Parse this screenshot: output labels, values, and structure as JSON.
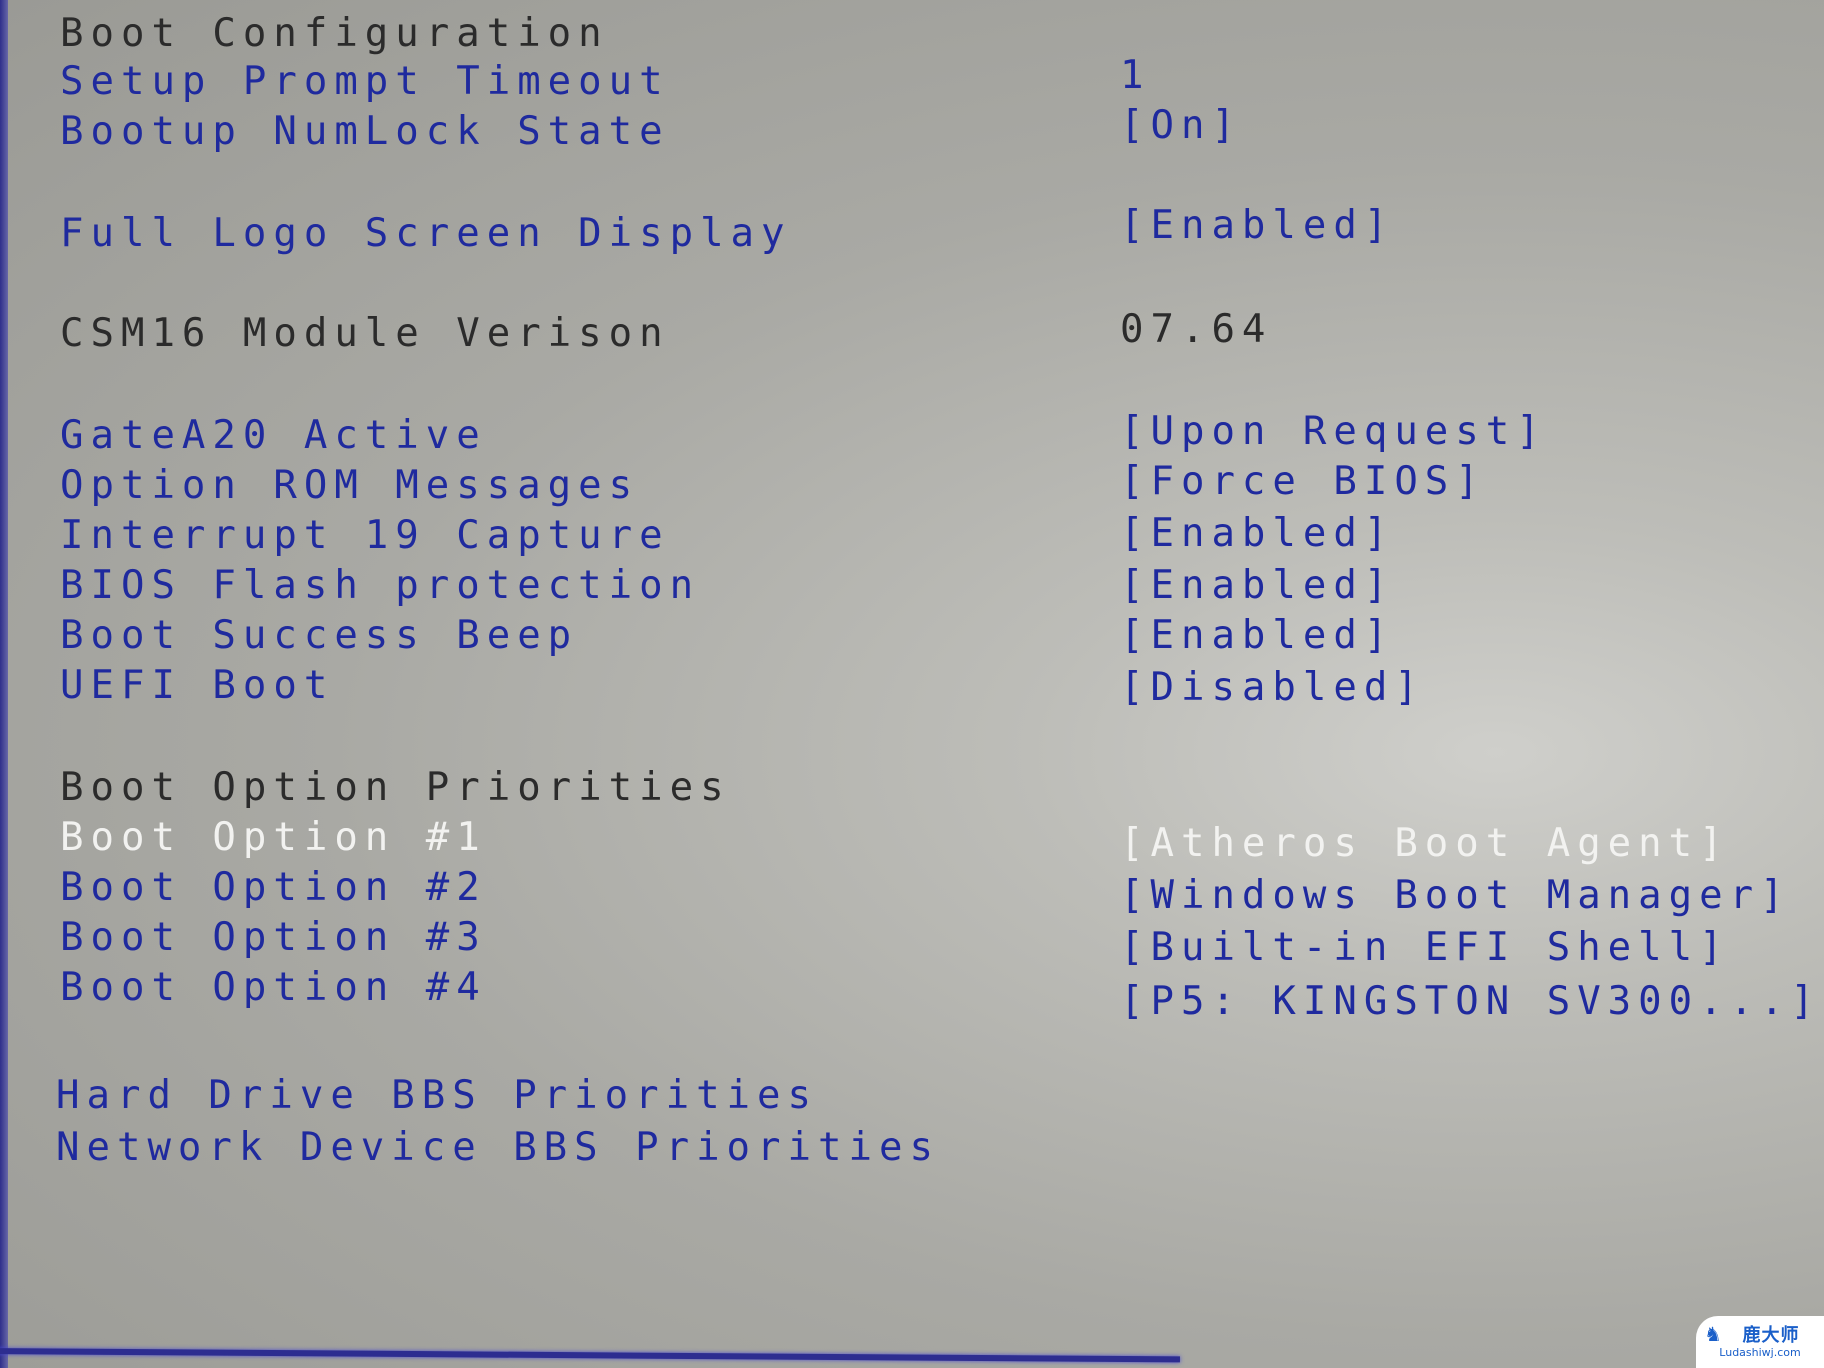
{
  "section_title": "Boot Configuration",
  "settings": [
    {
      "label": "Setup Prompt Timeout",
      "value": "1"
    },
    {
      "label": "Bootup NumLock State",
      "value": "[On]"
    },
    {
      "label": "Full Logo Screen Display",
      "value": "[Enabled]"
    },
    {
      "label": "CSM16 Module Verison",
      "value": "07.64"
    },
    {
      "label": "GateA20 Active",
      "value": "[Upon Request]"
    },
    {
      "label": "Option ROM Messages",
      "value": "[Force BIOS]"
    },
    {
      "label": "Interrupt 19 Capture",
      "value": "[Enabled]"
    },
    {
      "label": "BIOS Flash protection",
      "value": "[Enabled]"
    },
    {
      "label": "Boot Success Beep",
      "value": "[Enabled]"
    },
    {
      "label": "UEFI Boot",
      "value": "[Disabled]"
    }
  ],
  "boot_priorities": {
    "title": "Boot Option Priorities",
    "options": [
      {
        "label": "Boot Option #1",
        "value": "[Atheros Boot Agent]",
        "selected": true
      },
      {
        "label": "Boot Option #2",
        "value": "[Windows Boot Manager]"
      },
      {
        "label": "Boot Option #3",
        "value": "[Built-in EFI Shell]"
      },
      {
        "label": "Boot Option #4",
        "value": "[P5: KINGSTON SV300...]"
      }
    ]
  },
  "submenus": [
    {
      "label": "Hard Drive BBS Priorities"
    },
    {
      "label": "Network Device BBS Priorities"
    }
  ],
  "watermark": {
    "title": "鹿大师",
    "url": "Ludashiwj.com"
  },
  "colors": {
    "option_text": "#1f2a9e",
    "static_text": "#2b2b2b",
    "selected_text": "#f2f2f0"
  }
}
